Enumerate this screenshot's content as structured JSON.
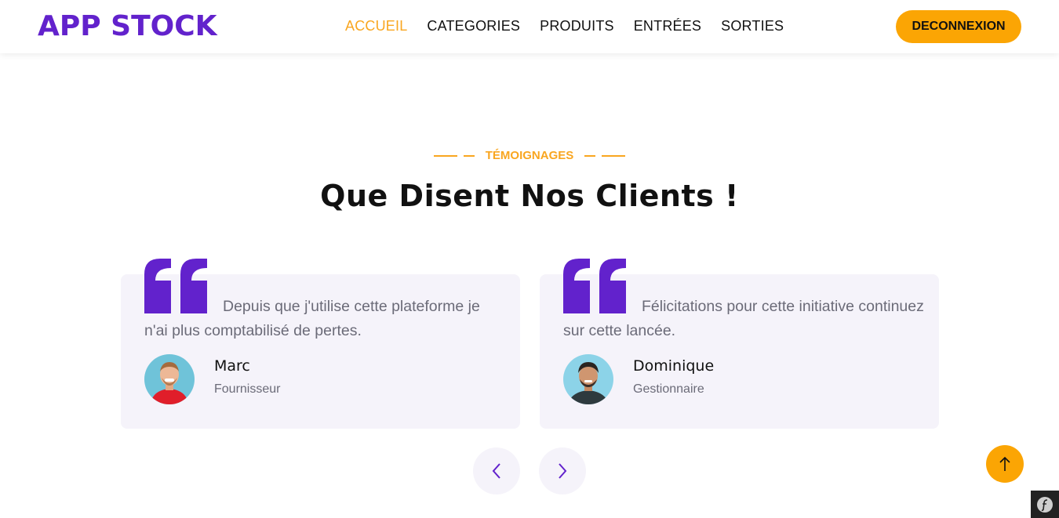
{
  "header": {
    "brand": "APP STOCK",
    "nav": [
      {
        "label": "ACCUEIL",
        "active": true
      },
      {
        "label": "CATEGORIES",
        "active": false
      },
      {
        "label": "PRODUITS",
        "active": false
      },
      {
        "label": "ENTRÉES",
        "active": false
      },
      {
        "label": "SORTIES",
        "active": false
      }
    ],
    "logout_label": "DECONNEXION"
  },
  "section": {
    "eyebrow": "TÉMOIGNAGES",
    "title": "Que Disent Nos Clients !"
  },
  "testimonials": [
    {
      "text": "Depuis que j'utilise cette plateforme je n'ai plus comptabilisé de pertes.",
      "name": "Marc",
      "role": "Fournisseur",
      "avatar": "avatar-marc"
    },
    {
      "text": "Félicitations pour cette initiative continuez sur cette lancée.",
      "name": "Dominique",
      "role": "Gestionnaire",
      "avatar": "avatar-dominique"
    }
  ],
  "controls": {
    "prev_icon": "chevron-left-icon",
    "next_icon": "chevron-right-icon",
    "back_to_top_icon": "arrow-up-icon",
    "debug_toolbar_icon": "symfony-icon"
  },
  "colors": {
    "brand": "#6222CC",
    "accent": "#FBA504",
    "card_bg": "#F5F3FA"
  }
}
